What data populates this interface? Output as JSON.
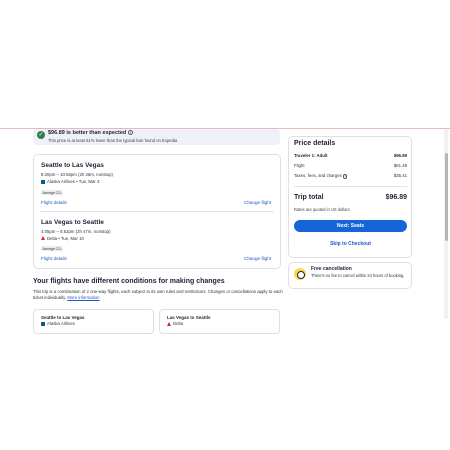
{
  "banner": {
    "title": "$96.89 is better than expected",
    "subtitle": "This price is at least 61% lower than the typical fare found on Expedia",
    "info_icon": "info-icon",
    "check_icon": "check-circle-icon"
  },
  "segments": [
    {
      "title": "Seattle to Las Vegas",
      "time": "8:20pm – 10:56pm (2h 36m, nonstop)",
      "airline": "Alaska Airlines • Tue, Mar 3",
      "co2": "Average CO₂",
      "details_link": "Flight details",
      "change_link": "Change flight"
    },
    {
      "title": "Las Vegas to Seattle",
      "time": "4:05pm – 6:52pm (2h 47m, nonstop)",
      "airline": "Delta • Tue, Mar 10",
      "co2": "Average CO₂",
      "details_link": "Flight details",
      "change_link": "Change flight"
    }
  ],
  "conditions": {
    "title": "Your flights have different conditions for making changes",
    "body": "This trip is a combination of 2 one-way flights, each subject to its own rules and restrictions. Changes or cancellations apply to each ticket individually.",
    "more_link": "More information",
    "cards": [
      {
        "title": "Seattle to Las Vegas",
        "airline": "Alaska Airlines"
      },
      {
        "title": "Las Vegas to Seattle",
        "airline": "Delta"
      }
    ]
  },
  "price": {
    "title": "Price details",
    "traveler_label": "Traveler 1: Adult",
    "traveler_value": "$96.89",
    "flight_label": "Flight",
    "flight_value": "$61.48",
    "taxes_label": "Taxes, fees, and charges",
    "taxes_value": "$35.41",
    "total_label": "Trip total",
    "total_value": "$96.89",
    "rates_note": "Rates are quoted in US dollars",
    "next_button": "Next: Seats",
    "skip_link": "Skip to Checkout"
  },
  "cancellation": {
    "title": "Free cancellation",
    "body": "There's no fee to cancel within 24 hours of booking."
  },
  "colors": {
    "primary_button": "#1565d8",
    "link": "#1f57c7",
    "success": "#2e7d4a",
    "cancel_icon": "#ffd84a"
  }
}
